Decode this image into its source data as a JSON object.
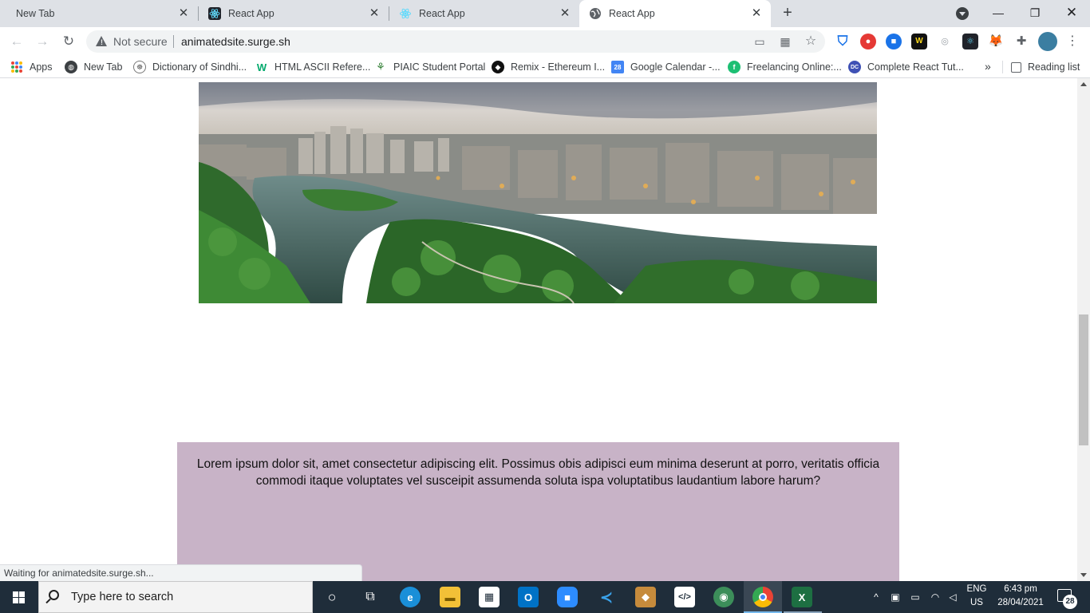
{
  "tabs": [
    {
      "title": "New Tab",
      "active": false
    },
    {
      "title": "React App",
      "active": false
    },
    {
      "title": "React App",
      "active": false
    },
    {
      "title": "React App",
      "active": true
    }
  ],
  "omnibox": {
    "security_label": "Not secure",
    "url": "animatedsite.surge.sh"
  },
  "bookmarks": [
    {
      "label": "Apps",
      "icon": "apps-grid-icon"
    },
    {
      "label": "New Tab",
      "icon": "globe-icon"
    },
    {
      "label": "Dictionary of Sindhi...",
      "icon": "dictionary-icon"
    },
    {
      "label": "HTML ASCII Refere...",
      "icon": "w3schools-icon"
    },
    {
      "label": "PIAIC Student Portal",
      "icon": "piaic-icon"
    },
    {
      "label": "Remix - Ethereum I...",
      "icon": "remix-icon"
    },
    {
      "label": "Google Calendar -...",
      "icon": "calendar-icon"
    },
    {
      "label": "Freelancing Online:...",
      "icon": "fiverr-icon"
    },
    {
      "label": "Complete React Tut...",
      "icon": "dc-icon"
    }
  ],
  "reading_list_label": "Reading list",
  "content": {
    "paragraph": "Lorem ipsum dolor sit, amet consectetur adipiscing elit. Possimus obis adipisci eum minima deserunt at porro, veritatis officia commodi itaque voluptates vel susceipit assumenda soluta ispa voluptatibus laudantium labore harum?",
    "box_color": "#c8b3c7"
  },
  "status_text": "Waiting for animatedsite.surge.sh...",
  "taskbar": {
    "search_placeholder": "Type here to search",
    "language": "ENG",
    "region": "US",
    "time": "6:43 pm",
    "date": "28/04/2021",
    "notification_count": "28"
  }
}
